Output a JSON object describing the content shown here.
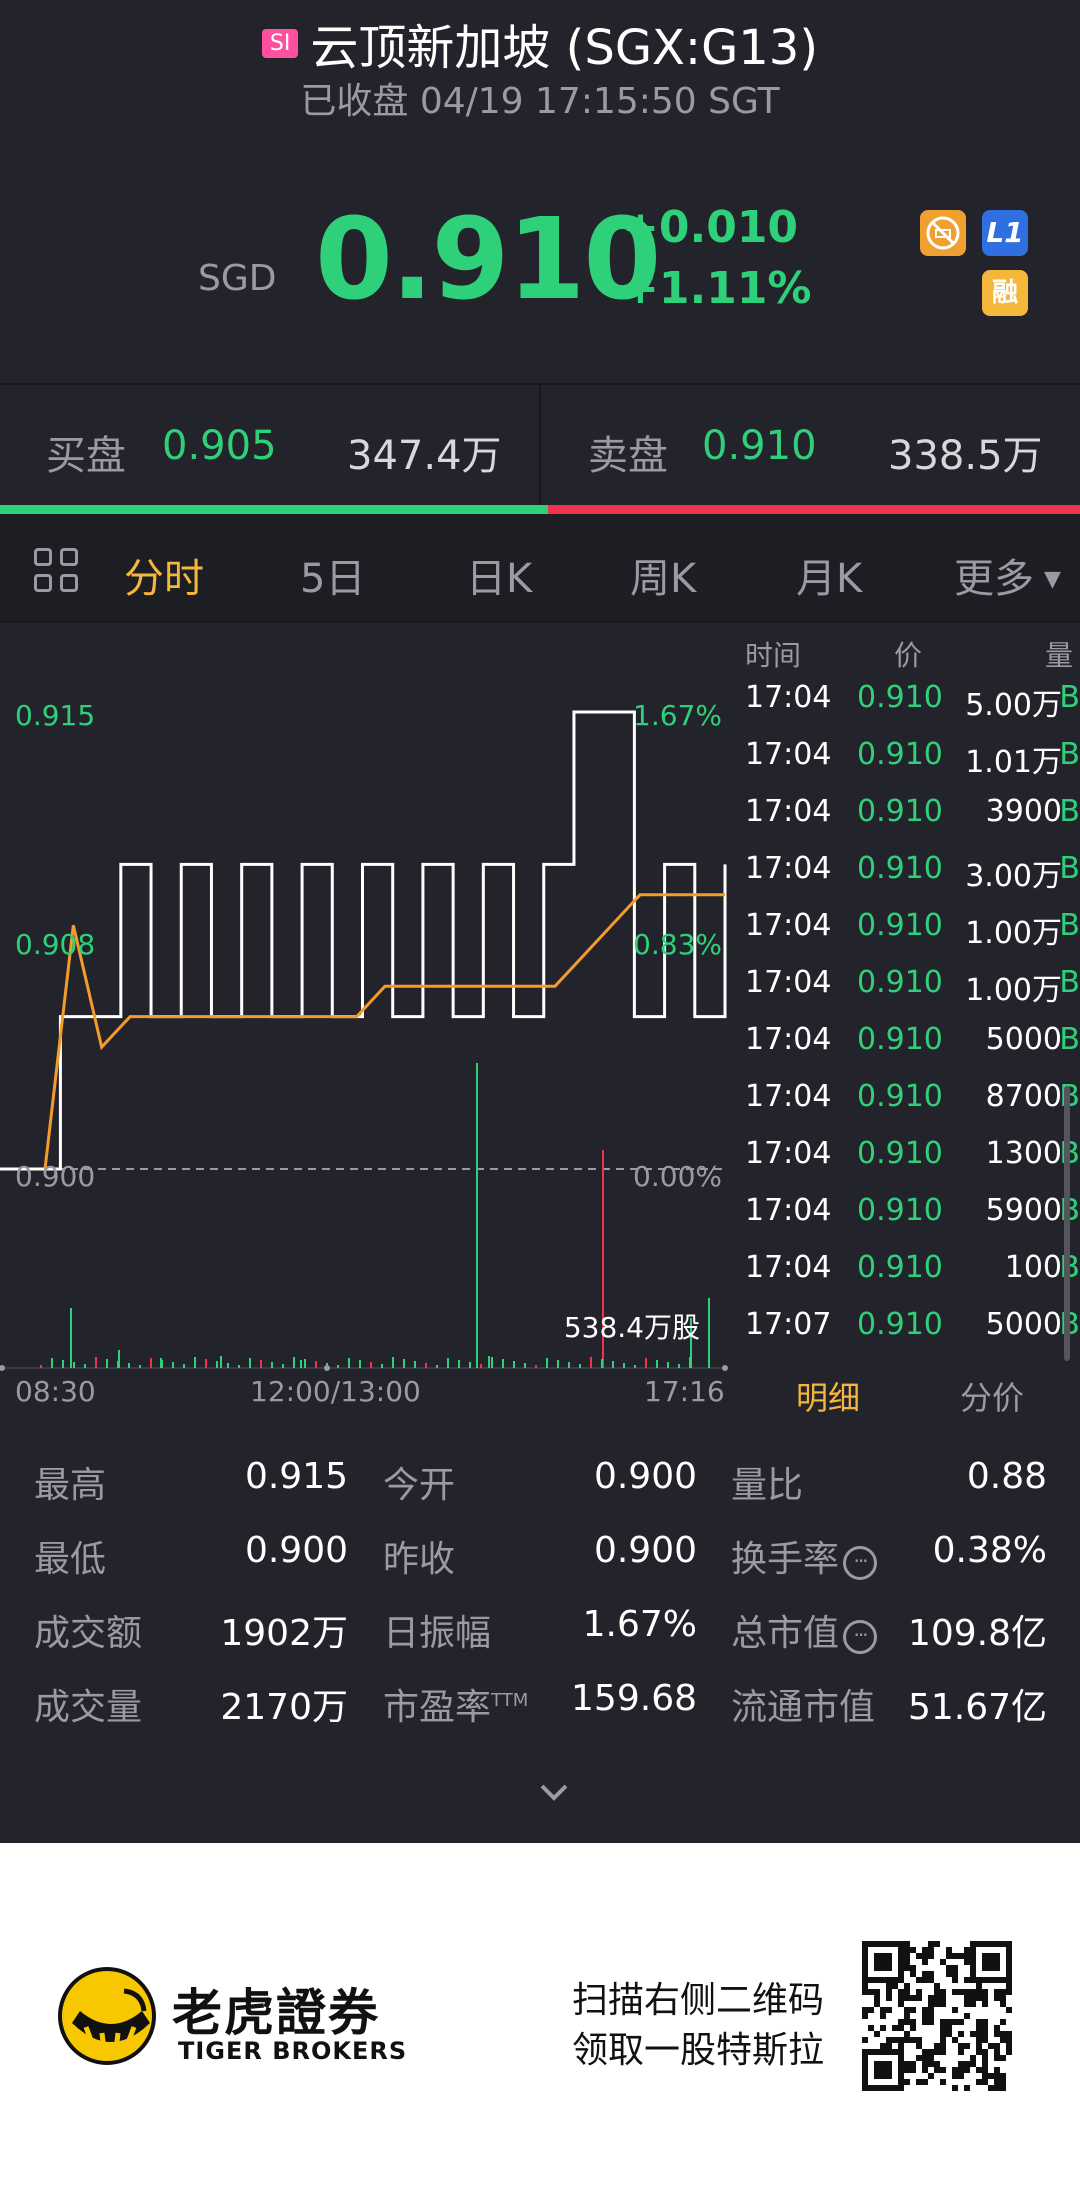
{
  "header": {
    "market_badge": "SI",
    "title": "云顶新加坡 (SGX:G13)",
    "status": "已收盘 04/19 17:15:50 SGT",
    "currency": "SGD",
    "price": "0.910",
    "change": "+0.010",
    "change_pct": "+1.11%",
    "icons": [
      "no-short-icon",
      "level1-icon",
      "margin-icon"
    ],
    "icon_l1_text": "L1",
    "icon_margin_text": "融"
  },
  "order_book": {
    "bid_label": "买盘",
    "bid_price": "0.905",
    "bid_volume": "347.4万",
    "ask_label": "卖盘",
    "ask_price": "0.910",
    "ask_volume": "338.5万",
    "bid_ratio": 0.51
  },
  "tabs": [
    {
      "label": "分时",
      "active": true
    },
    {
      "label": "5日"
    },
    {
      "label": "日K"
    },
    {
      "label": "周K"
    },
    {
      "label": "月K"
    },
    {
      "label": "更多"
    }
  ],
  "chart_data": {
    "type": "line",
    "y_left_ticks": [
      "0.915",
      "0.908",
      "0.900"
    ],
    "y_right_ticks": [
      "1.67%",
      "0.83%",
      "0.00%"
    ],
    "x_ticks": [
      "08:30",
      "12:00/13:00",
      "17:16"
    ],
    "prev_close": 0.9,
    "volume_label": "538.4万股",
    "series": [
      {
        "values": [
          0.9,
          0.9,
          0.905,
          0.905,
          0.91,
          0.905,
          0.91,
          0.905,
          0.91,
          0.905,
          0.91,
          0.905,
          0.91,
          0.905,
          0.91,
          0.905,
          0.91,
          0.905,
          0.91,
          0.915,
          0.915,
          0.905,
          0.91,
          0.905,
          0.91
        ]
      },
      {
        "values": [
          0.9,
          0.908,
          0.904,
          0.905,
          0.905,
          0.905,
          0.905,
          0.905,
          0.905,
          0.905,
          0.905,
          0.905,
          0.906,
          0.906,
          0.906,
          0.906,
          0.906,
          0.906,
          0.906,
          0.907,
          0.908,
          0.909,
          0.909,
          0.909,
          0.909
        ]
      }
    ]
  },
  "ticks_table": {
    "headers": [
      "时间",
      "价",
      "量"
    ],
    "rows": [
      {
        "time": "17:04",
        "price": "0.910",
        "volume": "5.00万",
        "side": "B"
      },
      {
        "time": "17:04",
        "price": "0.910",
        "volume": "1.01万",
        "side": "B"
      },
      {
        "time": "17:04",
        "price": "0.910",
        "volume": "3900",
        "side": "B"
      },
      {
        "time": "17:04",
        "price": "0.910",
        "volume": "3.00万",
        "side": "B"
      },
      {
        "time": "17:04",
        "price": "0.910",
        "volume": "1.00万",
        "side": "B"
      },
      {
        "time": "17:04",
        "price": "0.910",
        "volume": "1.00万",
        "side": "B"
      },
      {
        "time": "17:04",
        "price": "0.910",
        "volume": "5000",
        "side": "B"
      },
      {
        "time": "17:04",
        "price": "0.910",
        "volume": "8700",
        "side": "B"
      },
      {
        "time": "17:04",
        "price": "0.910",
        "volume": "1300",
        "side": "B"
      },
      {
        "time": "17:04",
        "price": "0.910",
        "volume": "5900",
        "side": "B"
      },
      {
        "time": "17:04",
        "price": "0.910",
        "volume": "100",
        "side": "B"
      },
      {
        "time": "17:07",
        "price": "0.910",
        "volume": "5000",
        "side": "B"
      }
    ],
    "tab_detail": "明细",
    "tab_price_dist": "分价"
  },
  "stats": [
    {
      "label": "最高",
      "value": "0.915"
    },
    {
      "label": "今开",
      "value": "0.900"
    },
    {
      "label": "量比",
      "value": "0.88"
    },
    {
      "label": "最低",
      "value": "0.900"
    },
    {
      "label": "昨收",
      "value": "0.900"
    },
    {
      "label": "换手率",
      "value": "0.38%",
      "info": true
    },
    {
      "label": "成交额",
      "value": "1902万"
    },
    {
      "label": "日振幅",
      "value": "1.67%"
    },
    {
      "label": "总市值",
      "value": "109.8亿",
      "info": true
    },
    {
      "label": "成交量",
      "value": "2170万"
    },
    {
      "label": "市盈率",
      "sup": "TTM",
      "value": "159.68"
    },
    {
      "label": "流通市值",
      "value": "51.67亿"
    }
  ],
  "footer": {
    "brand_cn": "老虎證券",
    "brand_en": "TIGER BROKERS",
    "promo_line1": "扫描右侧二维码",
    "promo_line2": "领取一股特斯拉"
  },
  "colors": {
    "background": "#23232b",
    "up_green": "#2fd07a",
    "down_red": "#f0334f",
    "accent_gold": "#f5b73b",
    "avg_line": "#f39c2c"
  }
}
